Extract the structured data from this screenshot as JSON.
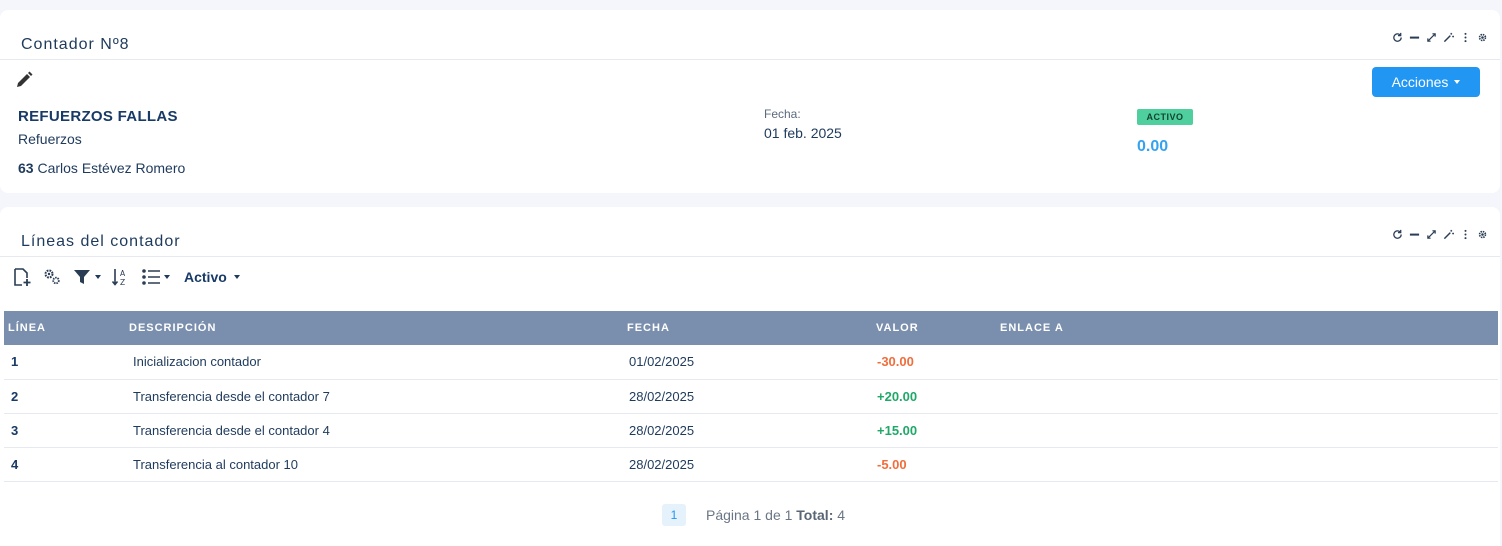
{
  "panel1": {
    "title": "Contador Nº8",
    "main_name": "REFUERZOS FALLAS",
    "subname": "Refuerzos",
    "person_id": "63",
    "person_name": "Carlos Estévez Romero",
    "fecha_label": "Fecha:",
    "fecha_value": "01 feb. 2025",
    "status_badge": "ACTIVO",
    "amount": "0.00",
    "actions_button": "Acciones"
  },
  "panel2": {
    "title": "Líneas del contador",
    "filter_label": "Activo",
    "table": {
      "headers": [
        "LÍNEA",
        "DESCRIPCIÓN",
        "FECHA",
        "VALOR",
        "ENLACE A"
      ],
      "rows": [
        {
          "linea": "1",
          "descripcion": "Inicializacion contador",
          "fecha": "01/02/2025",
          "valor": "-30.00",
          "enlace": ""
        },
        {
          "linea": "2",
          "descripcion": "Transferencia desde el contador 7",
          "fecha": "28/02/2025",
          "valor": "+20.00",
          "enlace": ""
        },
        {
          "linea": "3",
          "descripcion": "Transferencia desde el contador 4",
          "fecha": "28/02/2025",
          "valor": "+15.00",
          "enlace": ""
        },
        {
          "linea": "4",
          "descripcion": "Transferencia al contador 10",
          "fecha": "28/02/2025",
          "valor": "-5.00",
          "enlace": ""
        }
      ]
    },
    "pager": {
      "current_page": "1",
      "page_text": "Página 1 de 1",
      "total_label": "Total:",
      "total_value": "4"
    }
  },
  "colors": {
    "accent": "#2196f3",
    "header_bg": "#7a8fad",
    "negative": "#f06d3c",
    "positive": "#20a868",
    "badge": "#4fcf9e",
    "amount": "#33a3f0"
  },
  "icons": [
    "refresh-icon",
    "minimize-icon",
    "expand-icon",
    "magic-wand-icon",
    "more-vertical-icon",
    "gear-icon",
    "pencil-icon",
    "new-document-icon",
    "settings-gears-icon",
    "filter-icon",
    "sort-az-icon",
    "list-icon"
  ]
}
